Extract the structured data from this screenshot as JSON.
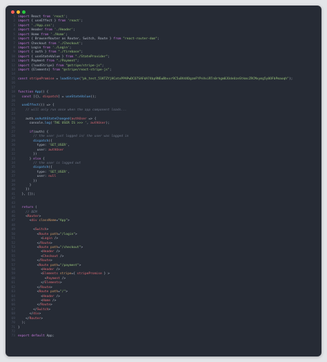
{
  "window": {
    "lines": [
      [
        [
          "kw",
          "import"
        ],
        [
          "pun",
          " React "
        ],
        [
          "kw",
          "from"
        ],
        [
          "str",
          " 'react'"
        ],
        [
          "pun",
          ";"
        ]
      ],
      [
        [
          "kw",
          "import"
        ],
        [
          "pun",
          " { useEffect } "
        ],
        [
          "kw",
          "from"
        ],
        [
          "str",
          " 'react'"
        ],
        [
          "pun",
          ";"
        ]
      ],
      [
        [
          "kw",
          "import"
        ],
        [
          "str",
          " './App.css'"
        ],
        [
          "pun",
          ";"
        ]
      ],
      [
        [
          "kw",
          "import"
        ],
        [
          "pun",
          " Header "
        ],
        [
          "kw",
          "from"
        ],
        [
          "str",
          " './Header'"
        ],
        [
          "pun",
          ";"
        ]
      ],
      [
        [
          "kw",
          "import"
        ],
        [
          "pun",
          " Home "
        ],
        [
          "kw",
          "from"
        ],
        [
          "str",
          " './Home'"
        ],
        [
          "pun",
          ";"
        ]
      ],
      [
        [
          "kw",
          "import"
        ],
        [
          "pun",
          " { BrowserRouter as Router, Switch, Route } "
        ],
        [
          "kw",
          "from"
        ],
        [
          "str",
          " \"react-router-dom\""
        ],
        [
          "pun",
          ";"
        ]
      ],
      [
        [
          "kw",
          "import"
        ],
        [
          "pun",
          " Checkout "
        ],
        [
          "kw",
          "from"
        ],
        [
          "str",
          " './Checkout'"
        ],
        [
          "pun",
          ";"
        ]
      ],
      [
        [
          "kw",
          "import"
        ],
        [
          "pun",
          " Login "
        ],
        [
          "kw",
          "from"
        ],
        [
          "str",
          " './Login'"
        ],
        [
          "pun",
          ";"
        ]
      ],
      [
        [
          "kw",
          "import"
        ],
        [
          "pun",
          " { auth } "
        ],
        [
          "kw",
          "from"
        ],
        [
          "str",
          " \"./firebase\""
        ],
        [
          "pun",
          ";"
        ]
      ],
      [
        [
          "kw",
          "import"
        ],
        [
          "pun",
          " { useStateValue } "
        ],
        [
          "kw",
          "from"
        ],
        [
          "str",
          " \"./StateProvider\""
        ],
        [
          "pun",
          ";"
        ]
      ],
      [
        [
          "kw",
          "import"
        ],
        [
          "pun",
          " Payment "
        ],
        [
          "kw",
          "from"
        ],
        [
          "str",
          " \"./Payment\""
        ],
        [
          "pun",
          ";"
        ]
      ],
      [
        [
          "kw",
          "import"
        ],
        [
          "pun",
          " {loadStripe} "
        ],
        [
          "kw",
          "from"
        ],
        [
          "str",
          " \"@stripe/stripe-js\""
        ],
        [
          "pun",
          ";"
        ]
      ],
      [
        [
          "kw",
          "import"
        ],
        [
          "pun",
          " {Elements} "
        ],
        [
          "kw",
          "from"
        ],
        [
          "str",
          " \"@stripe/react-stripe-js\""
        ],
        [
          "pun",
          ";"
        ]
      ],
      [],
      [
        [
          "kw",
          "const"
        ],
        [
          "var",
          " stripePromise"
        ],
        [
          "pun",
          " = "
        ],
        [
          "fn",
          "loadStripe"
        ],
        [
          "pun",
          "("
        ],
        [
          "str",
          "\"pk_test_51KTZYjHCatxPPAPwDCO7SAFdA74bp9NEwBbvxr9C5uBVdXDgzmFYPvVxiRTn0rhgm8JOdeUzeStkmcZRCMxymg5y0OFbPmaoqh\""
        ],
        [
          "pun",
          ");"
        ]
      ],
      [],
      [],
      [
        [
          "kw",
          "function"
        ],
        [
          "fn",
          " App"
        ],
        [
          "pun",
          "() {"
        ]
      ],
      [
        [
          "pun",
          "  "
        ],
        [
          "kw",
          "const"
        ],
        [
          "pun",
          " [{}, "
        ],
        [
          "var",
          "dispatch"
        ],
        [
          "pun",
          "] = "
        ],
        [
          "fn",
          "useStateValue"
        ],
        [
          "pun",
          "();"
        ]
      ],
      [],
      [
        [
          "pun",
          "  "
        ],
        [
          "fn",
          "useEffect"
        ],
        [
          "pun",
          "(() => {"
        ]
      ],
      [
        [
          "com",
          "    // will only run once when the app component loads..."
        ]
      ],
      [],
      [
        [
          "pun",
          "    auth."
        ],
        [
          "fn",
          "onAuthStateChanged"
        ],
        [
          "pun",
          "("
        ],
        [
          "var",
          "authUser"
        ],
        [
          "pun",
          " => {"
        ]
      ],
      [
        [
          "pun",
          "      console."
        ],
        [
          "fn",
          "log"
        ],
        [
          "pun",
          "("
        ],
        [
          "str",
          "'THE USER IS >>> '"
        ],
        [
          "pun",
          ", "
        ],
        [
          "var",
          "authUser"
        ],
        [
          "pun",
          ");"
        ]
      ],
      [],
      [
        [
          "pun",
          "      "
        ],
        [
          "kw",
          "if"
        ],
        [
          "pun",
          "(auth) {"
        ]
      ],
      [
        [
          "com",
          "        // the user just logged in/ the user was logged in"
        ]
      ],
      [
        [
          "pun",
          "        "
        ],
        [
          "fn",
          "dispatch"
        ],
        [
          "pun",
          "({"
        ]
      ],
      [
        [
          "pun",
          "          type: "
        ],
        [
          "str",
          "'SET_USER'"
        ],
        [
          "pun",
          ","
        ]
      ],
      [
        [
          "pun",
          "          user: "
        ],
        [
          "var",
          "authUser"
        ]
      ],
      [
        [
          "pun",
          "        })"
        ]
      ],
      [
        [
          "pun",
          "      } "
        ],
        [
          "kw",
          "else"
        ],
        [
          "pun",
          " {"
        ]
      ],
      [
        [
          "com",
          "        // the user is logged out"
        ]
      ],
      [
        [
          "pun",
          "        "
        ],
        [
          "fn",
          "dispatch"
        ],
        [
          "pun",
          "({"
        ]
      ],
      [
        [
          "pun",
          "          type: "
        ],
        [
          "str",
          "'SET_USER'"
        ],
        [
          "pun",
          ","
        ]
      ],
      [
        [
          "pun",
          "          user: "
        ],
        [
          "var",
          "null"
        ]
      ],
      [
        [
          "pun",
          "        })"
        ]
      ],
      [
        [
          "pun",
          "      }"
        ]
      ],
      [
        [
          "pun",
          "    })"
        ]
      ],
      [
        [
          "pun",
          "  }, []);"
        ]
      ],
      [],
      [],
      [
        [
          "pun",
          "  "
        ],
        [
          "kw",
          "return"
        ],
        [
          "pun",
          " ("
        ]
      ],
      [
        [
          "com",
          "    // BEM"
        ]
      ],
      [
        [
          "pun",
          "    <"
        ],
        [
          "tag",
          "Router"
        ],
        [
          "pun",
          ">"
        ]
      ],
      [
        [
          "pun",
          "      <"
        ],
        [
          "tag",
          "div"
        ],
        [
          "attr",
          " className"
        ],
        [
          "pun",
          "="
        ],
        [
          "str",
          "\"App\""
        ],
        [
          "pun",
          ">"
        ]
      ],
      [],
      [
        [
          "pun",
          "        <"
        ],
        [
          "tag",
          "Switch"
        ],
        [
          "pun",
          ">"
        ]
      ],
      [
        [
          "pun",
          "          <"
        ],
        [
          "tag",
          "Route"
        ],
        [
          "attr",
          " path"
        ],
        [
          "pun",
          "="
        ],
        [
          "str",
          "\"/login\""
        ],
        [
          "pun",
          ">"
        ]
      ],
      [
        [
          "pun",
          "            <"
        ],
        [
          "tag",
          "Login"
        ],
        [
          "pun",
          " />"
        ]
      ],
      [
        [
          "pun",
          "          </"
        ],
        [
          "tag",
          "Route"
        ],
        [
          "pun",
          ">"
        ]
      ],
      [
        [
          "pun",
          "          <"
        ],
        [
          "tag",
          "Route"
        ],
        [
          "attr",
          " path"
        ],
        [
          "pun",
          "="
        ],
        [
          "str",
          "\"/checkout\""
        ],
        [
          "pun",
          ">"
        ]
      ],
      [
        [
          "pun",
          "            <"
        ],
        [
          "tag",
          "Header"
        ],
        [
          "pun",
          " />"
        ]
      ],
      [
        [
          "pun",
          "            <"
        ],
        [
          "tag",
          "Checkout"
        ],
        [
          "pun",
          " />"
        ]
      ],
      [
        [
          "pun",
          "          </"
        ],
        [
          "tag",
          "Route"
        ],
        [
          "pun",
          ">"
        ]
      ],
      [
        [
          "pun",
          "          <"
        ],
        [
          "tag",
          "Route"
        ],
        [
          "attr",
          " path"
        ],
        [
          "pun",
          "="
        ],
        [
          "str",
          "\"/payment\""
        ],
        [
          "pun",
          ">"
        ]
      ],
      [
        [
          "pun",
          "            <"
        ],
        [
          "tag",
          "Header"
        ],
        [
          "pun",
          " />"
        ]
      ],
      [
        [
          "pun",
          "            <"
        ],
        [
          "tag",
          "Elements"
        ],
        [
          "attr",
          " stripe"
        ],
        [
          "pun",
          "={ "
        ],
        [
          "var",
          "stripePromise"
        ],
        [
          "pun",
          " } >"
        ]
      ],
      [
        [
          "pun",
          "              <"
        ],
        [
          "tag",
          "Payment"
        ],
        [
          "pun",
          " />"
        ]
      ],
      [
        [
          "pun",
          "            </"
        ],
        [
          "tag",
          "Elements"
        ],
        [
          "pun",
          ">"
        ]
      ],
      [
        [
          "pun",
          "          </"
        ],
        [
          "tag",
          "Route"
        ],
        [
          "pun",
          ">"
        ]
      ],
      [
        [
          "pun",
          "          <"
        ],
        [
          "tag",
          "Route"
        ],
        [
          "attr",
          " path"
        ],
        [
          "pun",
          "="
        ],
        [
          "str",
          "\"/\""
        ],
        [
          "pun",
          ">"
        ]
      ],
      [
        [
          "pun",
          "            <"
        ],
        [
          "tag",
          "Header"
        ],
        [
          "pun",
          " />"
        ]
      ],
      [
        [
          "pun",
          "            <"
        ],
        [
          "tag",
          "Home"
        ],
        [
          "pun",
          " />"
        ]
      ],
      [
        [
          "pun",
          "          </"
        ],
        [
          "tag",
          "Route"
        ],
        [
          "pun",
          ">"
        ]
      ],
      [
        [
          "pun",
          "        </"
        ],
        [
          "tag",
          "Switch"
        ],
        [
          "pun",
          ">"
        ]
      ],
      [
        [
          "pun",
          "      </"
        ],
        [
          "tag",
          "div"
        ],
        [
          "pun",
          ">"
        ]
      ],
      [
        [
          "pun",
          "    </"
        ],
        [
          "tag",
          "Router"
        ],
        [
          "pun",
          ">"
        ]
      ],
      [
        [
          "pun",
          "  );"
        ]
      ],
      [
        [
          "pun",
          "}"
        ]
      ],
      [],
      [
        [
          "kw",
          "export default"
        ],
        [
          "pun",
          " App;"
        ]
      ]
    ],
    "colors": {
      "background": "#262b35",
      "keyword": "#c678dd",
      "string": "#98c379",
      "function": "#61afef",
      "variable": "#e06c75",
      "comment": "#6b7384"
    }
  }
}
